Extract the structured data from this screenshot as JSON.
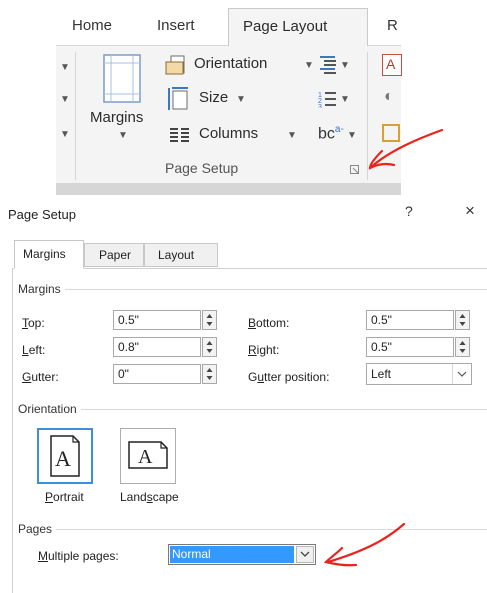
{
  "ribbon": {
    "tabs": [
      "Home",
      "Insert",
      "Page Layout",
      "R"
    ],
    "active_tab": "Page Layout",
    "margins_label": "Margins",
    "orientation_label": "Orientation",
    "size_label": "Size",
    "columns_label": "Columns",
    "hyphen_label": "bc",
    "group_label": "Page Setup"
  },
  "dialog": {
    "title": "Page Setup",
    "help_glyph": "?",
    "close_glyph": "×",
    "tabs": [
      "Margins",
      "Paper",
      "Layout"
    ],
    "active_tab": "Margins",
    "margins": {
      "section": "Margins",
      "top_label": "Top:",
      "top_value": "0.5\"",
      "left_label": "Left:",
      "left_value": "0.8\"",
      "gutter_label": "Gutter:",
      "gutter_value": "0\"",
      "bottom_label": "Bottom:",
      "bottom_value": "0.5\"",
      "right_label": "Right:",
      "right_value": "0.5\"",
      "gutter_position_label": "Gutter position:",
      "gutter_position_value": "Left"
    },
    "orientation": {
      "section": "Orientation",
      "portrait": "Portrait",
      "landscape": "Landscape",
      "icon_letter": "A",
      "selected": "Portrait"
    },
    "pages": {
      "section": "Pages",
      "multiple_label": "Multiple pages:",
      "multiple_value": "Normal"
    }
  },
  "colors": {
    "annotation": "#e8241c",
    "selection": "#3399ff",
    "selected_border": "#3c8fdc"
  },
  "icons": [
    "orientation-icon",
    "size-icon",
    "columns-icon",
    "breaks-icon",
    "line-numbers-icon",
    "hyphenation-icon",
    "margins-icon",
    "dialog-launcher-icon"
  ]
}
